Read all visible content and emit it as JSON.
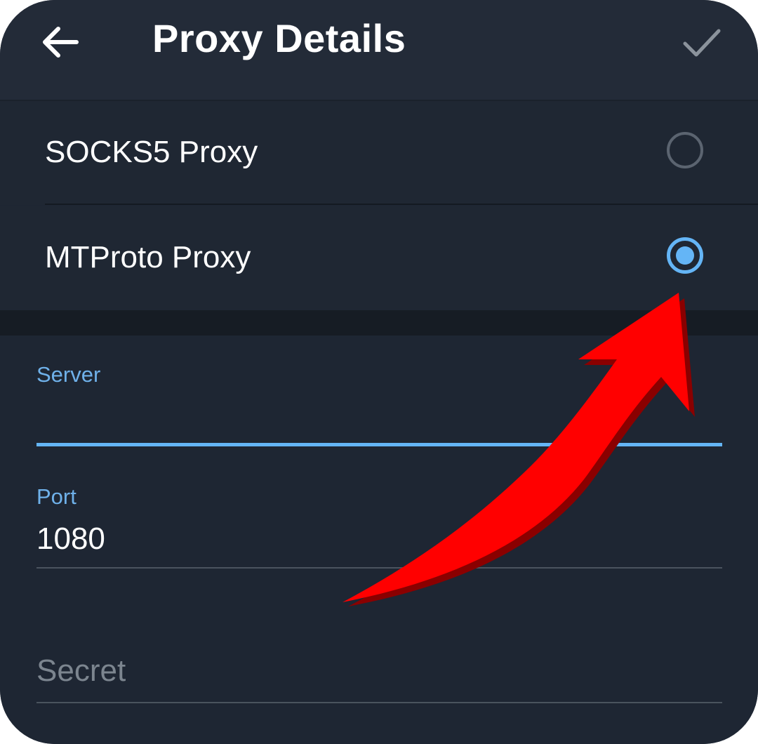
{
  "header": {
    "title": "Proxy Details",
    "back_icon": "arrow-left-icon",
    "done_icon": "checkmark-icon"
  },
  "proxy_types": [
    {
      "label": "SOCKS5 Proxy",
      "selected": false
    },
    {
      "label": "MTProto Proxy",
      "selected": true
    }
  ],
  "form": {
    "server": {
      "label": "Server",
      "value": ""
    },
    "port": {
      "label": "Port",
      "value": "1080"
    },
    "secret": {
      "placeholder": "Secret",
      "value": ""
    }
  },
  "annotation": {
    "icon": "red-curved-arrow-icon",
    "color": "#ff0000"
  },
  "colors": {
    "accent": "#64b5f6",
    "background": "#1e2633",
    "header": "#232b38"
  }
}
